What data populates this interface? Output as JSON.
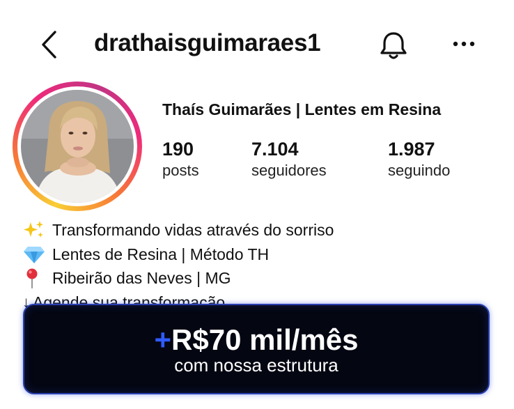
{
  "header": {
    "username": "drathaisguimaraes1",
    "back_icon": "chevron-left-icon",
    "notification_icon": "bell-icon",
    "more_icon": "more-horizontal-icon"
  },
  "profile": {
    "display_name": "Thaís Guimarães | Lentes em Resina",
    "avatar_gradient": [
      "#f9ce34",
      "#ee2a7b",
      "#c13584"
    ],
    "stats": [
      {
        "value": "190",
        "label": "posts"
      },
      {
        "value": "7.104",
        "label": "seguidores"
      },
      {
        "value": "1.987",
        "label": "seguindo"
      }
    ]
  },
  "bio": {
    "lines": [
      {
        "icon": "sparkles-icon",
        "text": "Transformando vidas através do sorriso"
      },
      {
        "icon": "gem-icon",
        "text": "Lentes de Resina | Método TH"
      },
      {
        "icon": "pin-icon",
        "text": "Ribeirão das Neves | MG"
      },
      {
        "icon": "arrow-down",
        "arrow": "↓",
        "text": "Agende sua transformação"
      }
    ]
  },
  "promo": {
    "plus": "+",
    "title": "R$70 mil/mês",
    "subtitle": "com nossa estrutura",
    "accent_color": "#2f5bff",
    "background_color": "#040612"
  }
}
